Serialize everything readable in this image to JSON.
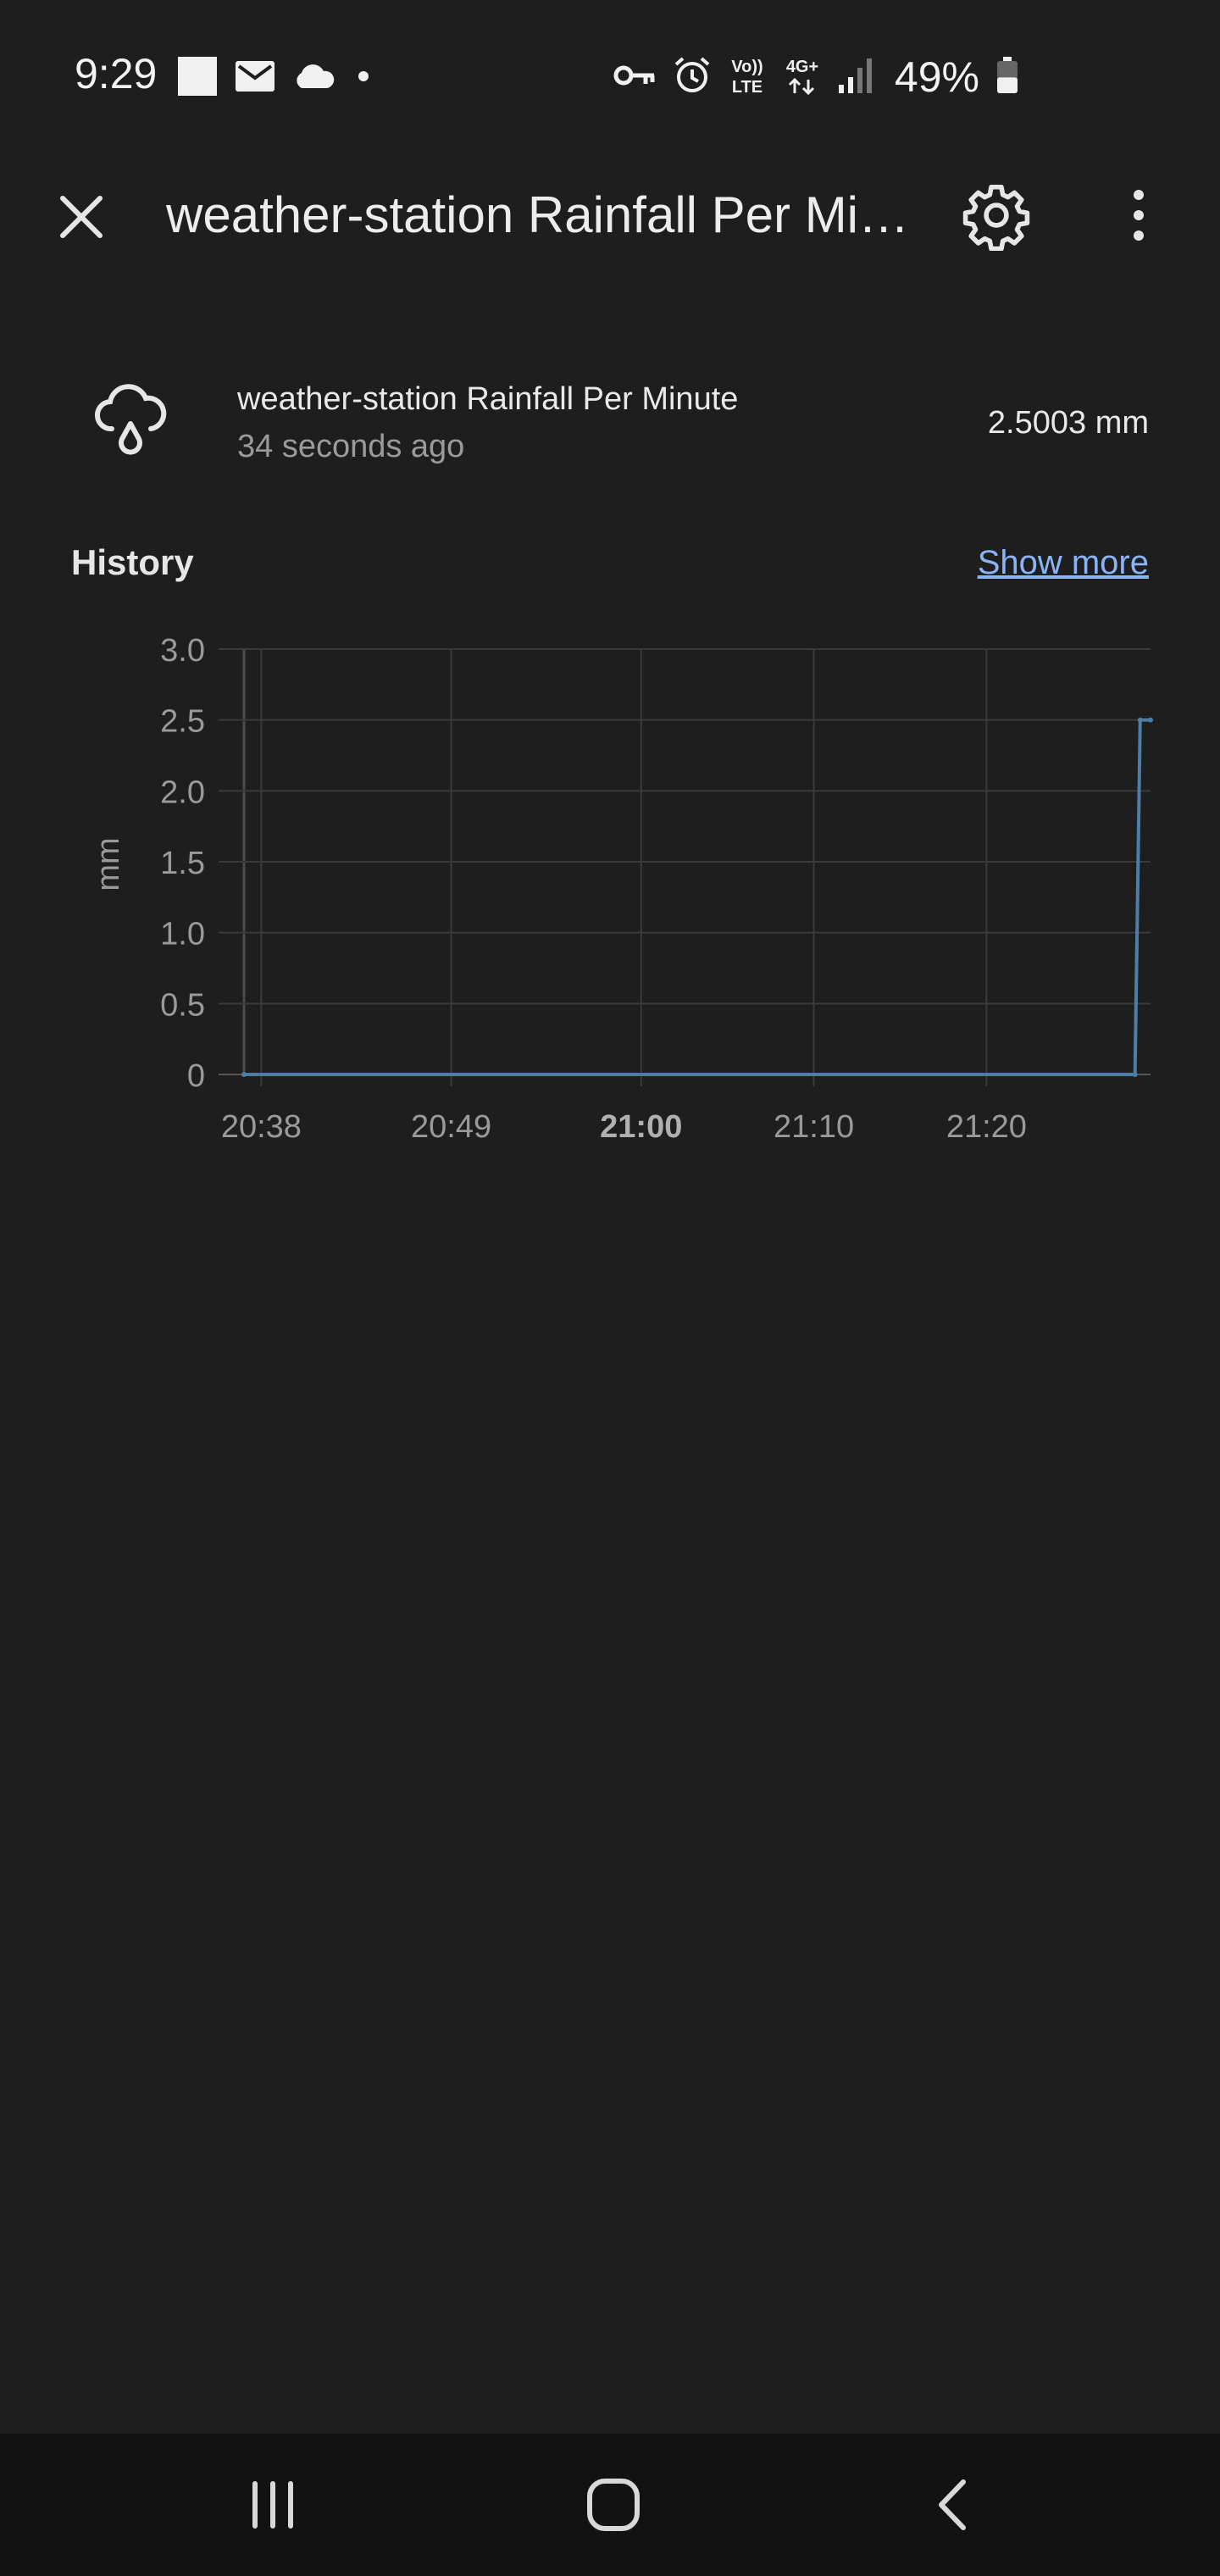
{
  "status_bar": {
    "time": "9:29",
    "left_icons": [
      "square-notification-icon",
      "mail-icon",
      "cloud-icon",
      "dot-icon"
    ],
    "right_icons": [
      "vpn-key-icon",
      "alarm-icon",
      "volte-icon",
      "4g-data-icon",
      "signal-icon"
    ],
    "volte_label_top": "Vo))",
    "volte_label_bottom": "LTE",
    "network_label": "4G+",
    "battery_percent": "49%",
    "battery_level": 0.49
  },
  "app_bar": {
    "title": "weather-station Rainfall Per Minute",
    "close_icon": "close-icon",
    "settings_icon": "gear-icon",
    "menu_icon": "more-vert-icon"
  },
  "entity": {
    "icon": "weather-rainy-icon",
    "name": "weather-station Rainfall Per Minute",
    "last_changed": "34 seconds ago",
    "state": "2.5003 mm"
  },
  "history": {
    "title": "History",
    "show_more_label": "Show more"
  },
  "chart_data": {
    "type": "line",
    "title": "",
    "xlabel": "",
    "ylabel": "mm",
    "ylim": [
      0,
      3.0
    ],
    "y_ticks": [
      "0",
      "0.5",
      "1.0",
      "1.5",
      "2.0",
      "2.5",
      "3.0"
    ],
    "y_tick_values": [
      0,
      0.5,
      1.0,
      1.5,
      2.0,
      2.5,
      3.0
    ],
    "x_ticks": [
      "20:38",
      "20:49",
      "21:00",
      "21:10",
      "21:20"
    ],
    "x_tick_minutes": [
      1238,
      1249,
      1260,
      1270,
      1280
    ],
    "x_tick_bold": [
      false,
      false,
      true,
      false,
      false
    ],
    "xlim_minutes": [
      1237,
      1289.5
    ],
    "grid": true,
    "legend": "none",
    "series": [
      {
        "color": "#4e7ea8",
        "x": [
          "20:37",
          "21:28",
          "21:28",
          "21:29"
        ],
        "x_minutes": [
          1237,
          1288.6,
          1288.9,
          1289.5
        ],
        "y": [
          0,
          0,
          2.5003,
          2.5003
        ]
      }
    ]
  },
  "nav_bar": {
    "recents_icon": "recents-icon",
    "home_icon": "home-icon",
    "back_icon": "back-icon"
  }
}
